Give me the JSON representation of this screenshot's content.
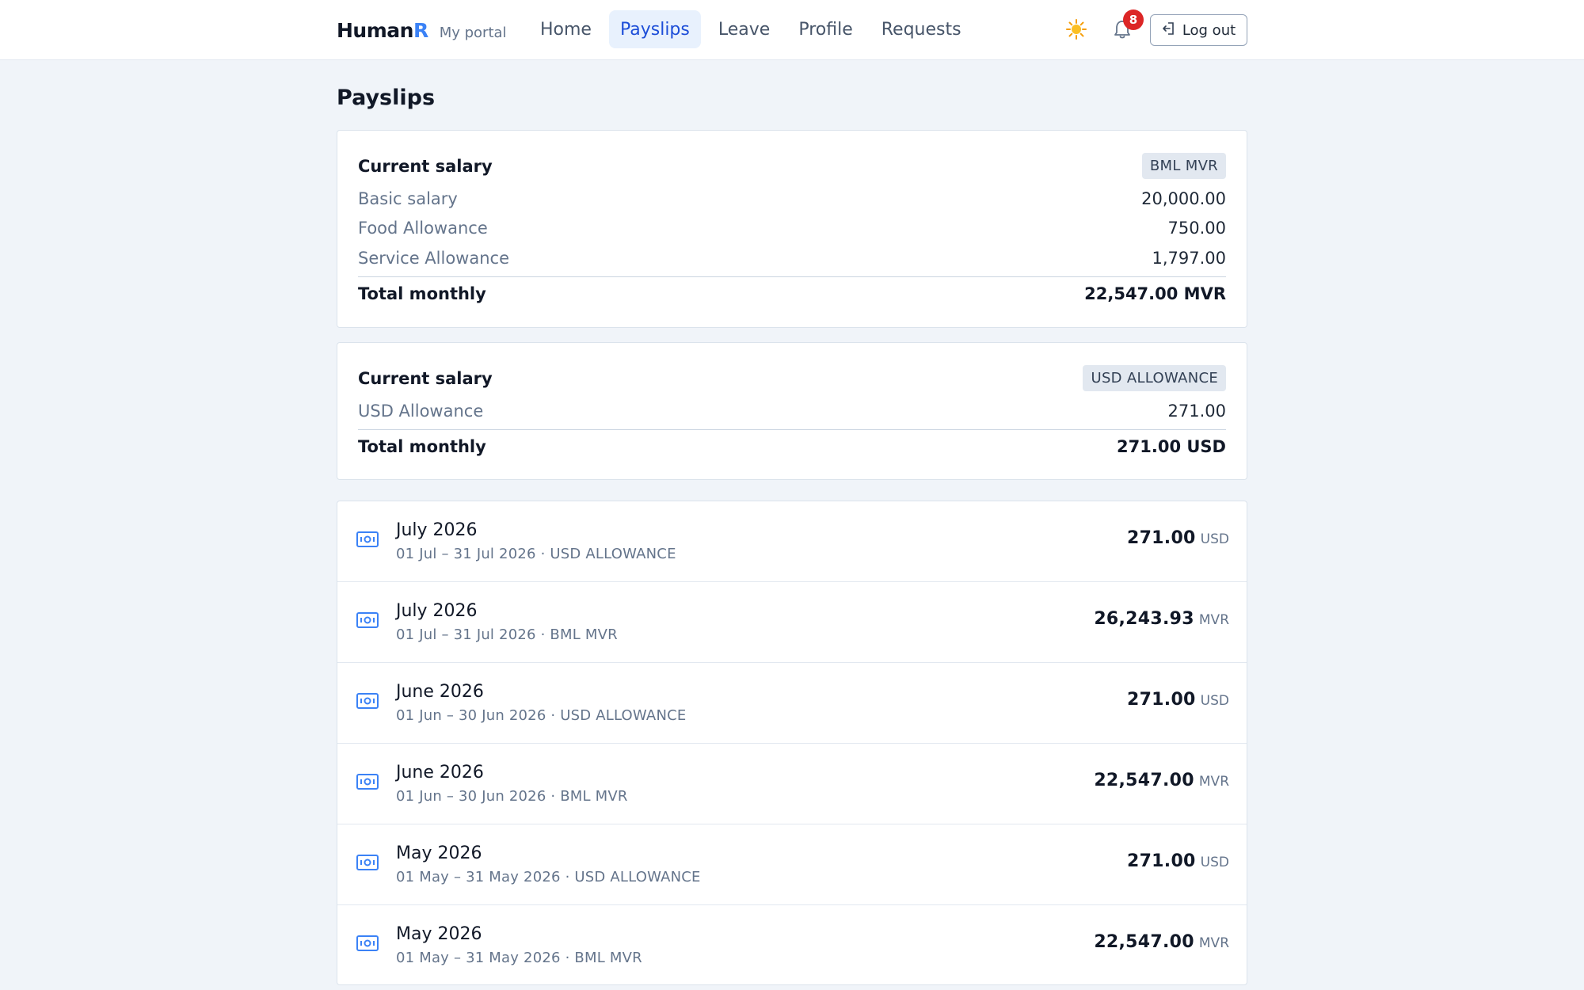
{
  "header": {
    "brand_name": "Human",
    "brand_accent": "R",
    "brand_sub": "My portal",
    "nav": [
      "Home",
      "Payslips",
      "Leave",
      "Profile",
      "Requests"
    ],
    "active_nav": "Payslips",
    "notification_count": "8",
    "logout_label": "Log out"
  },
  "page": {
    "title": "Payslips"
  },
  "salary_mvr": {
    "title": "Current salary",
    "tag": "BML MVR",
    "lines": [
      {
        "label": "Basic salary",
        "value": "20,000.00"
      },
      {
        "label": "Food Allowance",
        "value": "750.00"
      },
      {
        "label": "Service Allowance",
        "value": "1,797.00"
      }
    ],
    "total_label": "Total monthly",
    "total_value": "22,547.00 MVR"
  },
  "salary_usd": {
    "title": "Current salary",
    "tag": "USD ALLOWANCE",
    "lines": [
      {
        "label": "USD Allowance",
        "value": "271.00"
      }
    ],
    "total_label": "Total monthly",
    "total_value": "271.00 USD"
  },
  "payslips": [
    {
      "title": "July 2026",
      "sub": "01 Jul – 31 Jul 2026 · USD ALLOWANCE",
      "amount": "271.00",
      "currency": "USD"
    },
    {
      "title": "July 2026",
      "sub": "01 Jul – 31 Jul 2026 · BML MVR",
      "amount": "26,243.93",
      "currency": "MVR"
    },
    {
      "title": "June 2026",
      "sub": "01 Jun – 30 Jun 2026 · USD ALLOWANCE",
      "amount": "271.00",
      "currency": "USD"
    },
    {
      "title": "June 2026",
      "sub": "01 Jun – 30 Jun 2026 · BML MVR",
      "amount": "22,547.00",
      "currency": "MVR"
    },
    {
      "title": "May 2026",
      "sub": "01 May – 31 May 2026 · USD ALLOWANCE",
      "amount": "271.00",
      "currency": "USD"
    },
    {
      "title": "May 2026",
      "sub": "01 May – 31 May 2026 · BML MVR",
      "amount": "22,547.00",
      "currency": "MVR"
    }
  ],
  "colors": {
    "accent": "#3b82f6",
    "active_nav_bg": "#e8f1fd",
    "active_nav_text": "#1d4ed8",
    "badge": "#dc2626",
    "page_bg": "#f0f4f9"
  },
  "icons": {
    "theme": "sun-icon",
    "notifications": "bell-icon",
    "logout": "logout-icon",
    "payslip": "banknote-icon"
  }
}
